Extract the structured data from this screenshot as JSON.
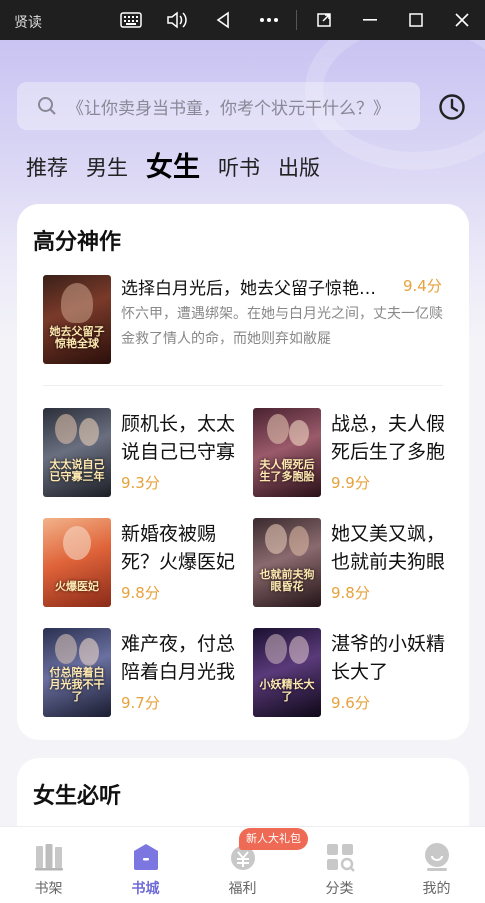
{
  "window": {
    "title": "贤读"
  },
  "search": {
    "placeholder": "《让你卖身当书童，你考个状元干什么？》"
  },
  "tabs": [
    {
      "label": "推荐",
      "active": false
    },
    {
      "label": "男生",
      "active": false
    },
    {
      "label": "女生",
      "active": true
    },
    {
      "label": "听书",
      "active": false
    },
    {
      "label": "出版",
      "active": false
    }
  ],
  "section1": {
    "title": "高分神作",
    "featured": {
      "title": "选择白月光后，她去父留子惊艳全球",
      "score": "9.4分",
      "description": "怀六甲，遭遇绑架。在她与白月光之间，丈夫一亿赎金救了情人的命，而她则弃如敝屣",
      "cover_text": "她去父留子惊艳全球"
    },
    "grid": [
      {
        "title": "顾机长，太太说自己已守寡三年",
        "score": "9.3分",
        "cover_text": "太太说自己已守寡三年"
      },
      {
        "title": "战总，夫人假死后生了多胞胎",
        "score": "9.9分",
        "cover_text": "夫人假死后生了多胞胎"
      },
      {
        "title": "新婚夜被赐死？火爆医妃",
        "score": "9.8分",
        "cover_text": "火爆医妃"
      },
      {
        "title": "她又美又飒，也就前夫狗眼昏花",
        "score": "9.8分",
        "cover_text": "也就前夫狗眼昏花"
      },
      {
        "title": "难产夜，付总陪着白月光我不干了",
        "score": "9.7分",
        "cover_text": "付总陪着白月光我不干了"
      },
      {
        "title": "湛爷的小妖精长大了",
        "score": "9.6分",
        "cover_text": "小妖精长大了"
      }
    ]
  },
  "section2": {
    "title": "女生必听"
  },
  "bottom_nav": {
    "items": [
      {
        "label": "书架",
        "icon": "bookshelf-icon",
        "active": false
      },
      {
        "label": "书城",
        "icon": "bookstore-icon",
        "active": true
      },
      {
        "label": "福利",
        "icon": "welfare-icon",
        "active": false
      },
      {
        "label": "分类",
        "icon": "category-icon",
        "active": false
      },
      {
        "label": "我的",
        "icon": "profile-icon",
        "active": false
      }
    ],
    "badge": "新人大礼包"
  },
  "colors": {
    "accent": "#6f6bd8",
    "score": "#e6a23c",
    "badge": "#ee6a55"
  }
}
